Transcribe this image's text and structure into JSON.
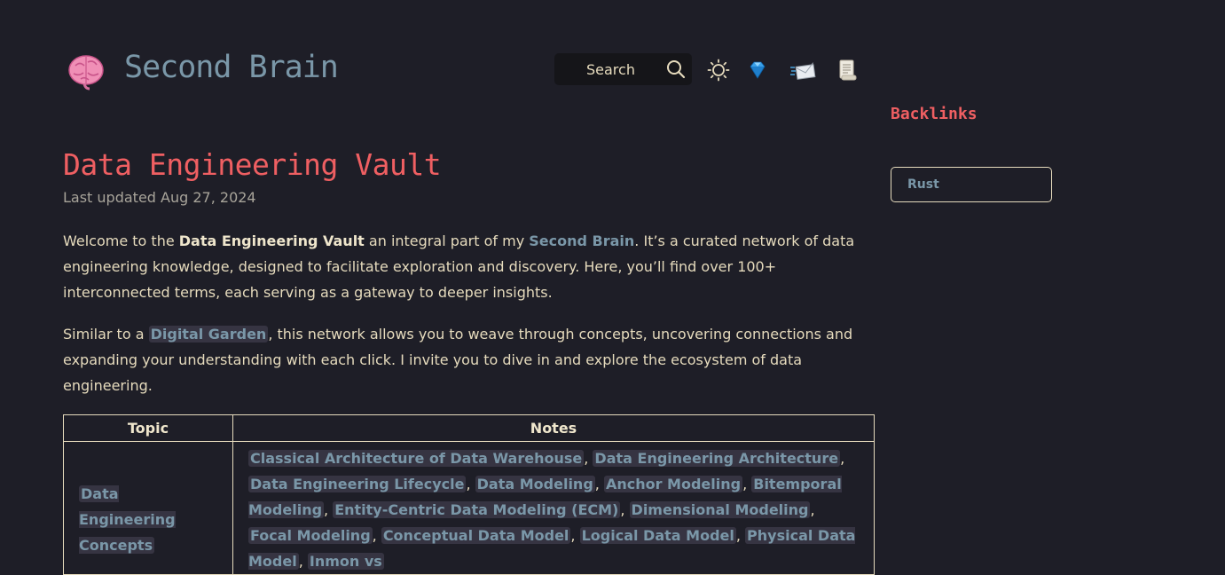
{
  "header": {
    "site_title": "Second Brain",
    "brain_icon": "brain-icon",
    "search_label": "Search",
    "icons": [
      "search-icon",
      "sun-icon",
      "gem-icon",
      "envelope-icon",
      "scroll-icon"
    ]
  },
  "sidebar": {
    "backlinks_title": "Backlinks",
    "backlinks": [
      "Rust"
    ]
  },
  "article": {
    "title": "Data Engineering Vault",
    "updated": "Last updated Aug 27, 2024",
    "p1": {
      "t1": "Welcome to the ",
      "bold": "Data Engineering Vault",
      "t2": " an integral part of my ",
      "link": "Second Brain",
      "t3": ". It’s a curated network of data engineering knowledge, designed to facilitate exploration and discovery. Here, you’ll find over 100+ interconnected terms, each serving as a gateway to deeper insights."
    },
    "p2": {
      "t1": "Similar to a ",
      "link": "Digital Garden",
      "t2": ", this network allows you to weave through concepts, uncovering connections and expanding your understanding with each click. I invite you to dive in and explore the ecosystem of data engineering."
    },
    "table": {
      "headers": [
        "Topic",
        "Notes"
      ],
      "rows": [
        {
          "topic": "Data Engineering Concepts",
          "notes": [
            "Classical Architecture of Data Warehouse",
            "Data Engineering Architecture",
            "Data Engineering Lifecycle",
            "Data Modeling",
            "Anchor Modeling",
            "Bitemporal Modeling",
            "Entity-Centric Data Modeling (ECM)",
            "Dimensional Modeling",
            "Focal Modeling",
            "Conceptual Data Model",
            "Logical Data Model",
            "Physical Data Model",
            "Inmon vs"
          ]
        }
      ]
    }
  },
  "colors": {
    "background": "#1e1e27",
    "accent": "#ef5f62",
    "link": "#7a97a8",
    "text": "#e6dbbd"
  }
}
